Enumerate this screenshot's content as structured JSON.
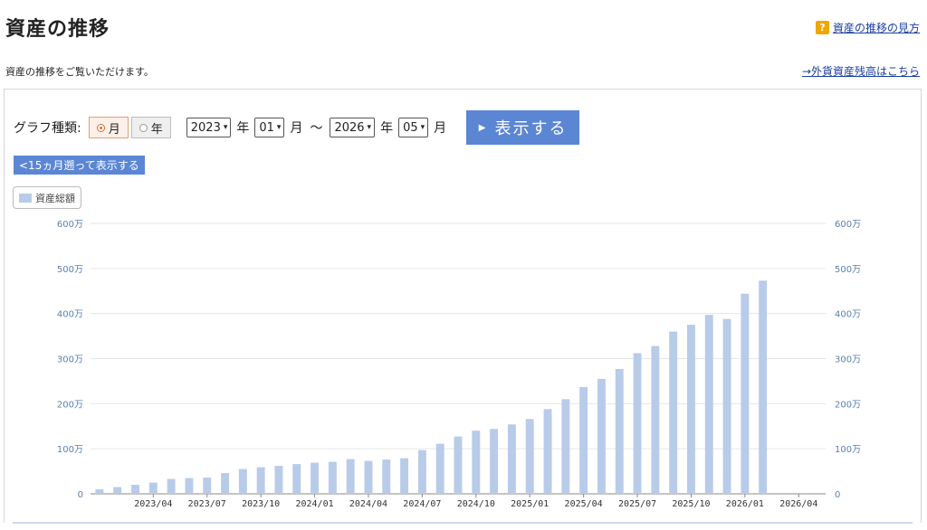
{
  "header": {
    "title": "資産の推移",
    "help_icon_text": "?",
    "help_link": "資産の推移の見方",
    "subtitle": "資産の推移をご覧いただけます。",
    "fx_link": "→外貨資産残高はこちら"
  },
  "controls": {
    "graph_type_label": "グラフ種類:",
    "month_label": "月",
    "year_label": "年",
    "selected_type": "月",
    "start_year": "2023",
    "start_month": "01",
    "end_year": "2026",
    "end_month": "05",
    "year_unit": "年",
    "month_unit": "月",
    "tilde": "〜",
    "show_button": "表示する",
    "back_button": "<15ヵ月遡って表示する"
  },
  "colors": {
    "bar": "#b8cbe9",
    "button": "#5b86d4",
    "link": "#1a3fa0",
    "axis_text": "#5b7fb0"
  },
  "chart_data": {
    "type": "bar",
    "legend": [
      "資産総額"
    ],
    "legend_position": "top-left",
    "grid": true,
    "ylim": [
      0,
      6000000
    ],
    "y_ticks": [
      {
        "value": 0,
        "label": "0"
      },
      {
        "value": 1000000,
        "label": "100万"
      },
      {
        "value": 2000000,
        "label": "200万"
      },
      {
        "value": 3000000,
        "label": "300万"
      },
      {
        "value": 4000000,
        "label": "400万"
      },
      {
        "value": 5000000,
        "label": "500万"
      },
      {
        "value": 6000000,
        "label": "600万"
      }
    ],
    "x_tick_labels": [
      "2023/04",
      "2023/07",
      "2023/10",
      "2024/01",
      "2024/04",
      "2024/07",
      "2024/10",
      "2025/01",
      "2025/04",
      "2025/07",
      "2025/10",
      "2026/01",
      "2026/04"
    ],
    "categories": [
      "2023/01",
      "2023/02",
      "2023/03",
      "2023/04",
      "2023/05",
      "2023/06",
      "2023/07",
      "2023/08",
      "2023/09",
      "2023/10",
      "2023/11",
      "2023/12",
      "2024/01",
      "2024/02",
      "2024/03",
      "2024/04",
      "2024/05",
      "2024/06",
      "2024/07",
      "2024/08",
      "2024/09",
      "2024/10",
      "2024/11",
      "2024/12",
      "2025/01",
      "2025/02",
      "2025/03",
      "2025/04",
      "2025/05",
      "2025/06",
      "2025/07",
      "2025/08",
      "2025/09",
      "2025/10",
      "2025/11",
      "2025/12",
      "2026/01",
      "2026/02",
      "2026/03",
      "2026/04",
      "2026/05"
    ],
    "series": [
      {
        "name": "資産総額",
        "values": [
          100000,
          150000,
          200000,
          250000,
          330000,
          350000,
          360000,
          460000,
          550000,
          590000,
          620000,
          660000,
          690000,
          710000,
          770000,
          730000,
          760000,
          790000,
          970000,
          1110000,
          1270000,
          1400000,
          1440000,
          1540000,
          1660000,
          1880000,
          2100000,
          2370000,
          2550000,
          2770000,
          3120000,
          3280000,
          3600000,
          3750000,
          3970000,
          3880000,
          4440000,
          4730000
        ]
      }
    ]
  }
}
